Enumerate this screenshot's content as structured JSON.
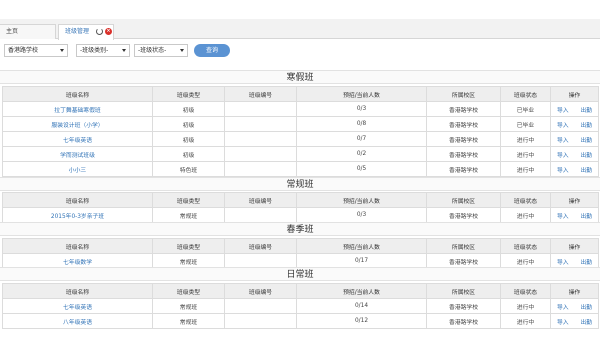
{
  "tabs": [
    {
      "label": "主页"
    },
    {
      "label": "班级管理"
    }
  ],
  "filters": {
    "school": "香港路学校",
    "category": "-班级类别-",
    "status": "-班级状态-",
    "query_label": "查询"
  },
  "columns": [
    "班级名称",
    "班级类型",
    "班级编号",
    "预招/当前人数",
    "所属校区",
    "班级状态",
    "操作"
  ],
  "sections": [
    {
      "title": "寒假班",
      "columns": [
        "班级名称",
        "班级类型",
        "班级编号",
        "预招/当前人数",
        "所属校区",
        "班级状态",
        "操作"
      ],
      "rows": [
        {
          "name": "拉丁舞基础寒假班",
          "type": "初级",
          "code": "",
          "count": "0/3",
          "campus": "香港路学校",
          "status": "已毕业",
          "op1": "导入",
          "op2": "出勤"
        },
        {
          "name": "服装设计班（小学）",
          "type": "初级",
          "code": "",
          "count": "0/8",
          "campus": "香港路学校",
          "status": "已毕业",
          "op1": "导入",
          "op2": "出勤"
        },
        {
          "name": "七年级英语",
          "type": "初级",
          "code": "",
          "count": "0/7",
          "campus": "香港路学校",
          "status": "进行中",
          "op1": "导入",
          "op2": "出勤"
        },
        {
          "name": "学而测试班级",
          "type": "初级",
          "code": "",
          "count": "0/2",
          "campus": "香港路学校",
          "status": "进行中",
          "op1": "导入",
          "op2": "出勤"
        },
        {
          "name": "小小三",
          "type": "特色班",
          "code": "",
          "count": "0/5",
          "campus": "香港路学校",
          "status": "进行中",
          "op1": "导入",
          "op2": "出勤"
        }
      ]
    },
    {
      "title": "常规班",
      "columns": [
        "班级名称",
        "班级类型",
        "班级编号",
        "预招/当前人数",
        "所属校区",
        "班级状态",
        "操作"
      ],
      "rows": [
        {
          "name": "2015年0-3岁亲子班",
          "type": "常规班",
          "code": "",
          "count": "0/3",
          "campus": "香港路学校",
          "status": "进行中",
          "op1": "导入",
          "op2": "出勤"
        }
      ]
    },
    {
      "title": "春季班",
      "columns": [
        "班级名称",
        "班级类型",
        "班级编号",
        "预招/当前人数",
        "所属校区",
        "班级状态",
        "操作"
      ],
      "rows": [
        {
          "name": "七年级数学",
          "type": "常规班",
          "code": "",
          "count": "0/17",
          "campus": "香港路学校",
          "status": "进行中",
          "op1": "导入",
          "op2": "出勤"
        }
      ]
    },
    {
      "title": "日常班",
      "columns": [
        "班级名称",
        "班级类型",
        "班级编号",
        "预招/当前人数",
        "所属校区",
        "班级状态",
        "操作"
      ],
      "rows": [
        {
          "name": "七年级英语",
          "type": "常规班",
          "code": "",
          "count": "0/14",
          "campus": "香港路学校",
          "status": "进行中",
          "op1": "导入",
          "op2": "出勤"
        },
        {
          "name": "八年级英语",
          "type": "常规班",
          "code": "",
          "count": "0/12",
          "campus": "香港路学校",
          "status": "进行中",
          "op1": "导入",
          "op2": "出勤"
        }
      ]
    }
  ]
}
